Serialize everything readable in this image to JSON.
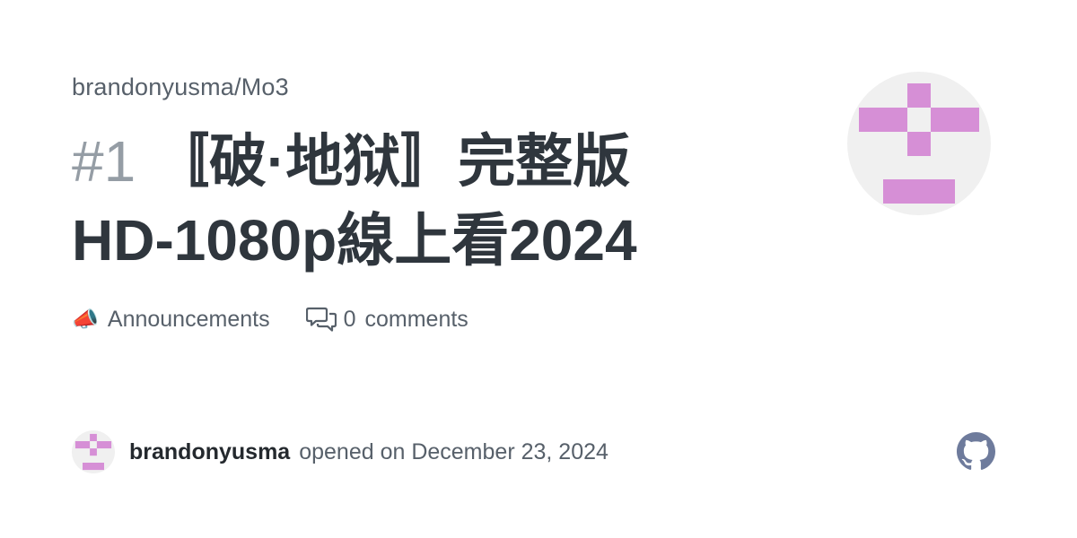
{
  "repo": {
    "path": "brandonyusma/Mo3"
  },
  "issue": {
    "number": "#1",
    "title": "〚破·地狱〛完整版 HD-1080p線上看2024"
  },
  "meta": {
    "category_emoji": "📣",
    "category": "Announcements",
    "comment_count": "0",
    "comments_label": "comments"
  },
  "footer": {
    "author": "brandonyusma",
    "opened_text": "opened on December 23, 2024"
  },
  "colors": {
    "identicon": "#d68fd6",
    "avatar_bg": "#f0f0f0",
    "title": "#2f363d",
    "muted": "#57606a",
    "github_logo": "#6e7b9c"
  },
  "icons": {
    "category": "megaphone-emoji",
    "comments": "comment-discussion-icon",
    "brand": "github-logo-icon"
  }
}
